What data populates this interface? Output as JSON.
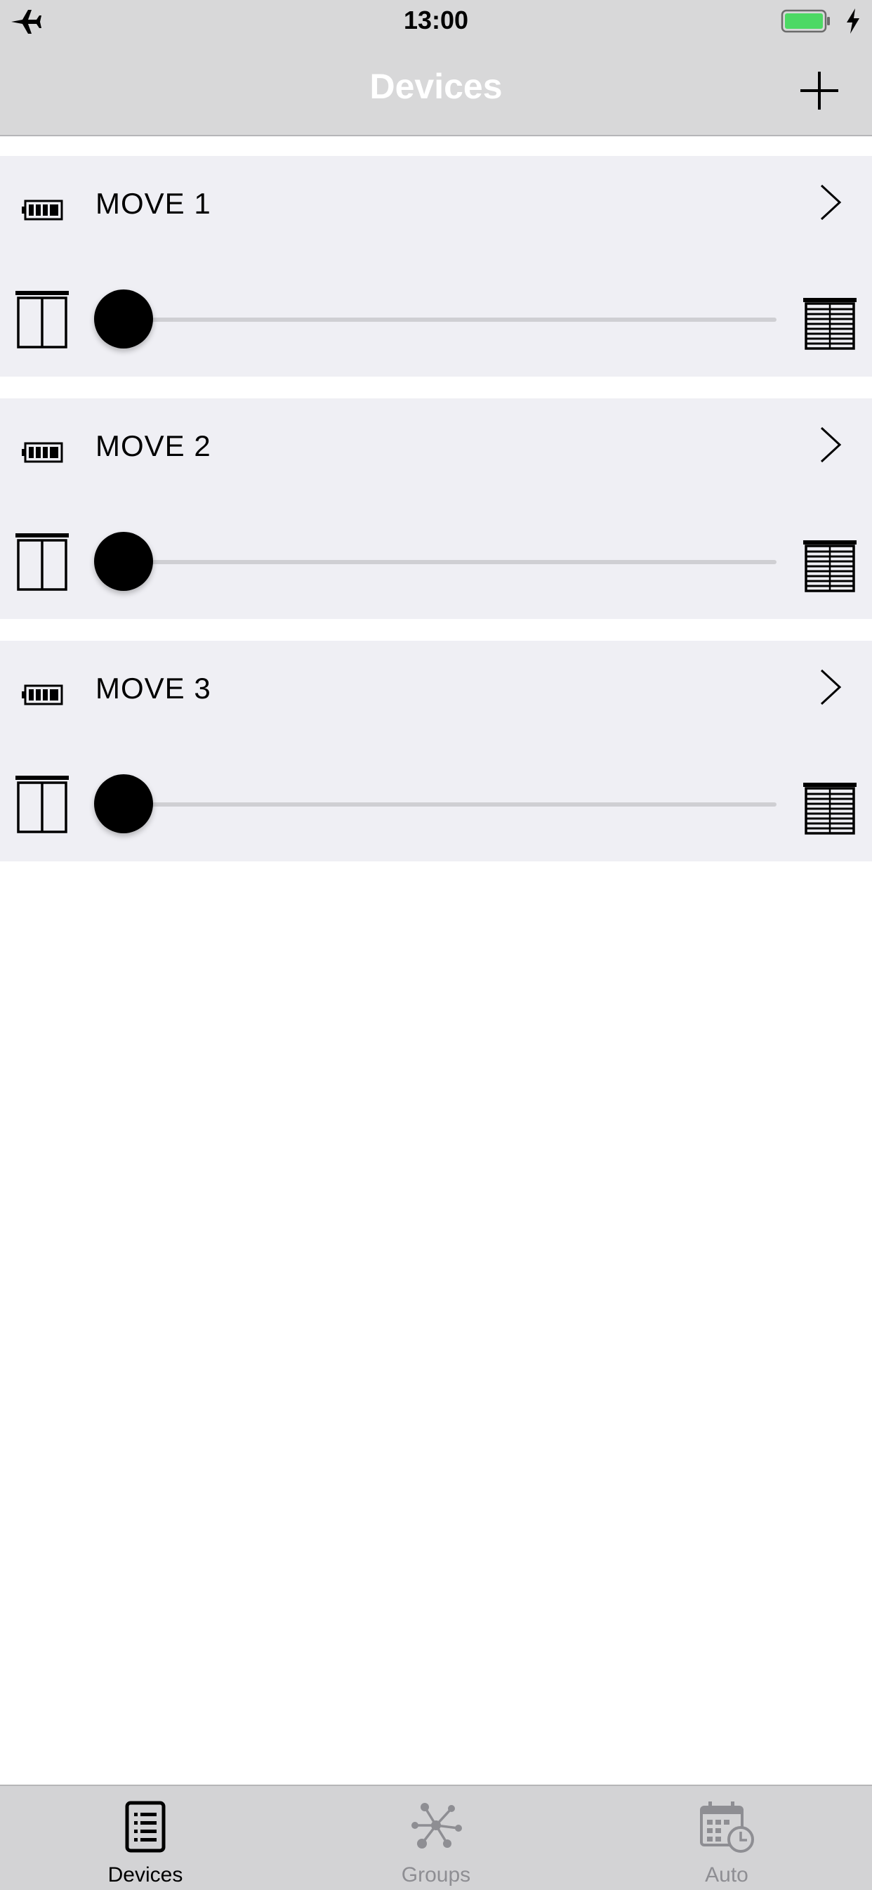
{
  "status_bar": {
    "time": "13:00",
    "airplane_icon": "airplane-icon",
    "battery_icon": "battery-full-charging-icon",
    "battery_color": "#4cd964"
  },
  "nav": {
    "title": "Devices",
    "add_icon": "plus-icon"
  },
  "devices": [
    {
      "name": "MOVE 1",
      "position": 0
    },
    {
      "name": "MOVE 2",
      "position": 0
    },
    {
      "name": "MOVE 3",
      "position": 0
    }
  ],
  "tabs": [
    {
      "label": "Devices",
      "icon": "list-document-icon",
      "active": true
    },
    {
      "label": "Groups",
      "icon": "network-nodes-icon",
      "active": false
    },
    {
      "label": "Auto",
      "icon": "calendar-clock-icon",
      "active": false
    }
  ],
  "colors": {
    "bar_background": "#d8d8d9",
    "card_background": "#efeff4",
    "inactive_tab": "#8e8e93"
  }
}
